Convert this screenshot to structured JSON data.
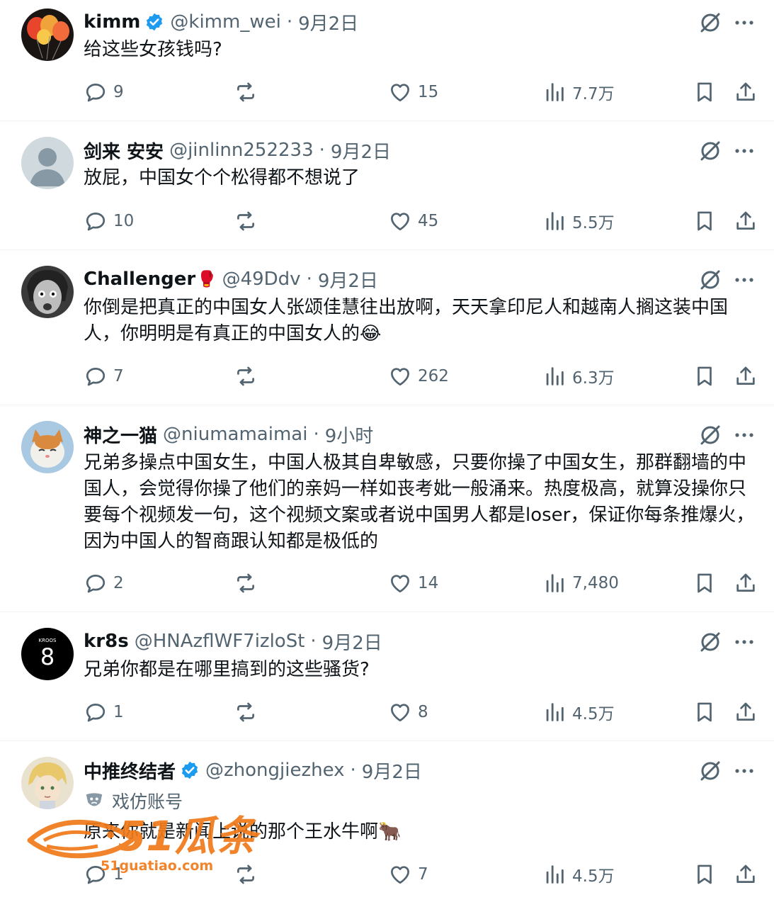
{
  "tweets": [
    {
      "name": "kimm",
      "verified": true,
      "emoji": "",
      "handle": "@kimm_wei",
      "time": "9月2日",
      "text": "给这些女孩钱吗?",
      "parody_label": "",
      "replies": "9",
      "retweets": "",
      "likes": "15",
      "views": "7.7万",
      "avatar": "balloons-avatar"
    },
    {
      "name": "剑来 安安",
      "verified": false,
      "emoji": "",
      "handle": "@jinlinn252233",
      "time": "9月2日",
      "text": "放屁，中国女个个松得都不想说了",
      "parody_label": "",
      "replies": "10",
      "retweets": "",
      "likes": "45",
      "views": "5.5万",
      "avatar": "default-avatar"
    },
    {
      "name": "Challenger",
      "verified": false,
      "emoji": "🥊",
      "handle": "@49Ddv",
      "time": "9月2日",
      "text": "你倒是把真正的中国女人张颂佳慧往出放啊，天天拿印尼人和越南人搁这装中国人，你明明是有真正的中国女人的😂",
      "parody_label": "",
      "replies": "7",
      "retweets": "",
      "likes": "262",
      "views": "6.3万",
      "avatar": "anime-face-avatar"
    },
    {
      "name": "神之一猫",
      "verified": false,
      "emoji": "",
      "handle": "@niumamaimai",
      "time": "9小时",
      "text": "兄弟多操点中国女生，中国人极其自卑敏感，只要你操了中国女生，那群翻墙的中国人，会觉得你操了他们的亲妈一样如丧考妣一般涌来。热度极高，就算没操你只要每个视频发一句，这个视频文案或者说中国男人都是loser，保证你每条推爆火，因为中国人的智商跟认知都是极低的",
      "parody_label": "",
      "replies": "2",
      "retweets": "",
      "likes": "14",
      "views": "7,480",
      "avatar": "cat-avatar"
    },
    {
      "name": "kr8s",
      "verified": false,
      "emoji": "",
      "handle": "@HNAzflWF7izloSt",
      "time": "9月2日",
      "text": "兄弟你都是在哪里搞到的这些骚货?",
      "parody_label": "",
      "replies": "1",
      "retweets": "",
      "likes": "8",
      "views": "4.5万",
      "avatar": "kroos-8-avatar",
      "avatar_small_text": "KROOS",
      "avatar_number": "8"
    },
    {
      "name": "中推终结者",
      "verified": true,
      "emoji": "",
      "handle": "@zhongjiezhex",
      "time": "9月2日",
      "text": "原来你就是新闻上说的那个王水牛啊🐂",
      "parody_label": "戏仿账号",
      "replies": "1",
      "retweets": "",
      "likes": "7",
      "views": "4.5万",
      "avatar": "anime-blonde-avatar"
    }
  ],
  "watermark": {
    "main": "51瓜条",
    "url": "51guatiao.com"
  },
  "colors": {
    "text": "#0f1419",
    "secondary": "#536471",
    "verified": "#1d9bf0",
    "divider": "#eff3f4",
    "watermark": "#f07a1a"
  }
}
